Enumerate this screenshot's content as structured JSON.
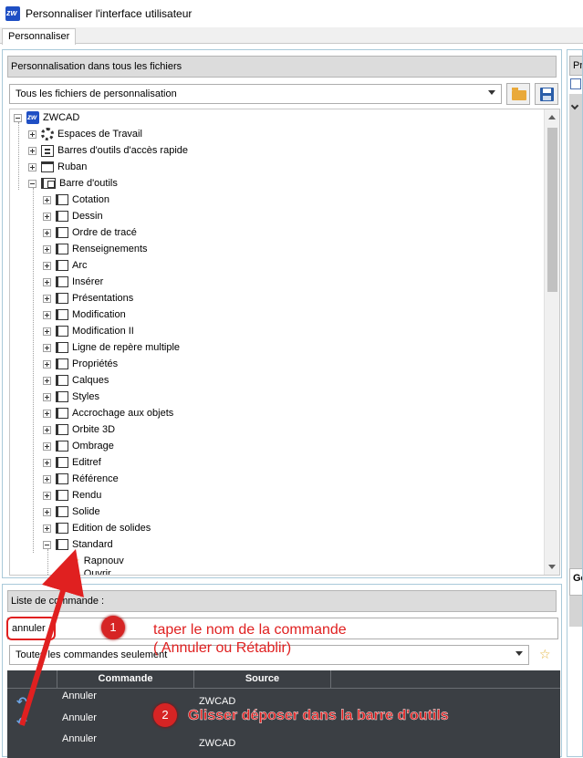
{
  "window": {
    "title": "Personnaliser l'interface utilisateur",
    "app_icon": "zwcad-icon"
  },
  "tabs": [
    {
      "label": "Personnaliser"
    }
  ],
  "customization": {
    "header": "Personnalisation dans tous les fichiers",
    "file_selector": "Tous les fichiers de personnalisation",
    "tree": {
      "root": "ZWCAD",
      "level1": [
        "Espaces de Travail",
        "Barres d'outils d'accès rapide",
        "Ruban",
        "Barre d'outils"
      ],
      "toolbars": [
        "Cotation",
        "Dessin",
        "Ordre de tracé",
        "Renseignements",
        "Arc",
        "Insérer",
        "Présentations",
        "Modification",
        "Modification II",
        "Ligne de repère multiple",
        "Propriétés",
        "Calques",
        "Styles",
        "Accrochage aux objets",
        "Orbite 3D",
        "Ombrage",
        "Editref",
        "Référence",
        "Rendu",
        "Solide",
        "Edition de solides",
        "Standard"
      ],
      "standard_children": [
        "Rapnouv",
        "Ouvrir"
      ]
    }
  },
  "right_panel": {
    "header_partial": "Pro",
    "section_partial": "Gé"
  },
  "command_list": {
    "header": "Liste de commande :",
    "search_value": "annuler",
    "filter": "Toutes les commandes seulement",
    "columns": [
      "Commande",
      "Source"
    ],
    "rows": [
      {
        "command": "Annuler",
        "source": "ZWCAD"
      },
      {
        "command": "Annuler",
        "source": ""
      },
      {
        "command": "Annuler",
        "source": "ZWCAD"
      }
    ]
  },
  "annotations": {
    "step1_number": "1",
    "step1_text_line1": "taper le nom de la commande",
    "step1_text_line2": "( Annuler ou Rétablir)",
    "step2_number": "2",
    "step2_text": "Glisser déposer dans la barre d'outils",
    "accent_color": "#e02020"
  }
}
